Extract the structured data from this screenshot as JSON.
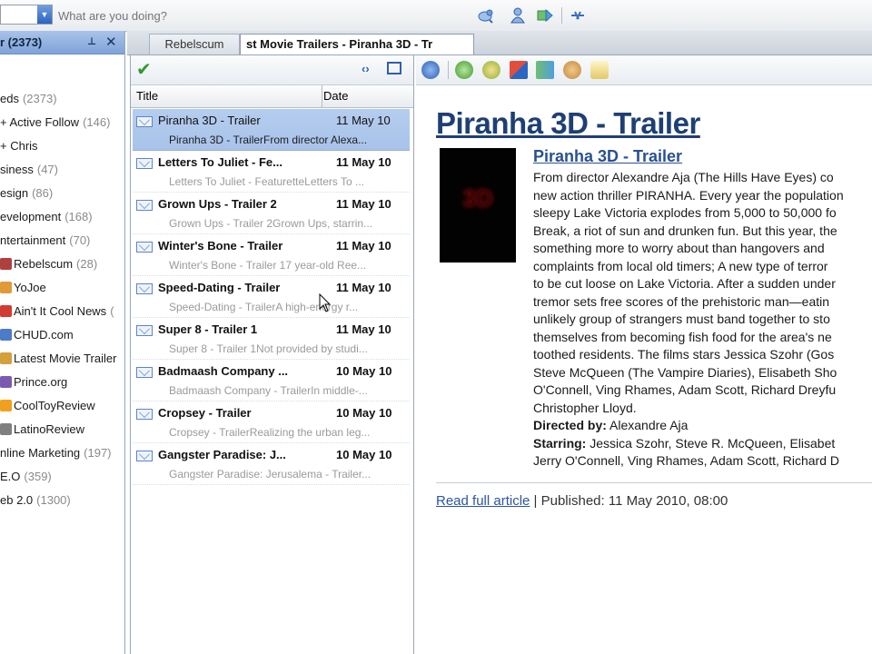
{
  "topbar": {
    "status_placeholder": "What are you doing?",
    "icons": [
      "twitter-bird-icon",
      "user-icon",
      "forward-icon",
      "link-icon"
    ]
  },
  "left_pane": {
    "header_title": "r (2373)",
    "pin_glyph": "⊥",
    "close_glyph": "✕",
    "feeds": [
      {
        "label": "eds",
        "count": "(2373)"
      },
      {
        "label": "+ Active Follow",
        "count": "(146)"
      },
      {
        "label": "+ Chris",
        "count": ""
      },
      {
        "label": "siness",
        "count": "(47)"
      },
      {
        "label": "esign",
        "count": "(86)"
      },
      {
        "label": "evelopment",
        "count": "(168)"
      },
      {
        "label": "ntertainment",
        "count": "(70)"
      },
      {
        "label": "Rebelscum",
        "count": "(28)"
      },
      {
        "label": "YoJoe",
        "count": ""
      },
      {
        "label": "Ain't It Cool News",
        "count": "("
      },
      {
        "label": "CHUD.com",
        "count": ""
      },
      {
        "label": "Latest Movie Trailer",
        "count": ""
      },
      {
        "label": "Prince.org",
        "count": ""
      },
      {
        "label": "CoolToyReview",
        "count": ""
      },
      {
        "label": "LatinoReview",
        "count": ""
      },
      {
        "label": "nline Marketing",
        "count": "(197)"
      },
      {
        "label": "E.O",
        "count": "(359)"
      },
      {
        "label": "eb 2.0",
        "count": "(1300)"
      }
    ]
  },
  "tabs": [
    {
      "label": "Rebelscum"
    },
    {
      "label": "st Movie Trailers - Piranha 3D - Tr"
    }
  ],
  "message_list": {
    "col_title": "Title",
    "col_date": "Date",
    "messages": [
      {
        "title": "Piranha 3D - Trailer",
        "date": "11 May 10",
        "snippet": "Piranha 3D - TrailerFrom director Alexa...",
        "selected": true
      },
      {
        "title": "Letters To Juliet - Fe...",
        "date": "11 May 10",
        "snippet": "Letters To Juliet - FeaturetteLetters To ..."
      },
      {
        "title": "Grown Ups - Trailer 2",
        "date": "11 May 10",
        "snippet": "Grown Ups - Trailer 2Grown Ups, starrin..."
      },
      {
        "title": "Winter's Bone - Trailer",
        "date": "11 May 10",
        "snippet": "Winter's Bone - Trailer 17 year-old Ree..."
      },
      {
        "title": "Speed-Dating - Trailer",
        "date": "11 May 10",
        "snippet": "Speed-Dating - TrailerA high-energy r..."
      },
      {
        "title": "Super 8 - Trailer 1",
        "date": "11 May 10",
        "snippet": "Super 8 - Trailer 1Not provided by studi..."
      },
      {
        "title": "Badmaash Company ...",
        "date": "10 May 10",
        "snippet": "Badmaash Company - TrailerIn middle-..."
      },
      {
        "title": "Cropsey - Trailer",
        "date": "10 May 10",
        "snippet": "Cropsey - TrailerRealizing the urban leg..."
      },
      {
        "title": "Gangster Paradise: J...",
        "date": "10 May 10",
        "snippet": "Gangster Paradise: Jerusalema - Trailer..."
      }
    ]
  },
  "article": {
    "title": "Piranha 3D - Trailer",
    "subtitle": "Piranha 3D - Trailer",
    "thumb_text": "3D",
    "body_lines": [
      "From director Alexandre Aja (The Hills Have Eyes) co",
      "new action thriller PIRANHA. Every year the population",
      "sleepy Lake Victoria explodes from 5,000 to 50,000 fo",
      "Break, a riot of sun and drunken fun. But this year, the",
      "something more to worry about than hangovers and",
      "complaints from local old timers; A new type of terror",
      "to be cut loose on Lake Victoria. After a sudden under",
      "tremor sets free scores of the prehistoric man—eatin",
      "unlikely group of strangers must band together to sto",
      "themselves from becoming fish food for the area's ne",
      "toothed residents. The films stars Jessica Szohr (Gos",
      "Steve McQueen (The Vampire Diaries), Elisabeth Sho",
      "O'Connell, Ving Rhames, Adam Scott, Richard Dreyfu",
      "Christopher Lloyd."
    ],
    "directed_label": "Directed by:",
    "directed_value": " Alexandre Aja",
    "starring_label": "Starring:",
    "starring_value": " Jessica Szohr, Steve R. McQueen, Elisabet",
    "starring_value2": "Jerry O'Connell, Ving Rhames, Adam Scott, Richard D",
    "read_full": "Read full article",
    "published": " | Published: 11 May 2010, 08:00"
  }
}
